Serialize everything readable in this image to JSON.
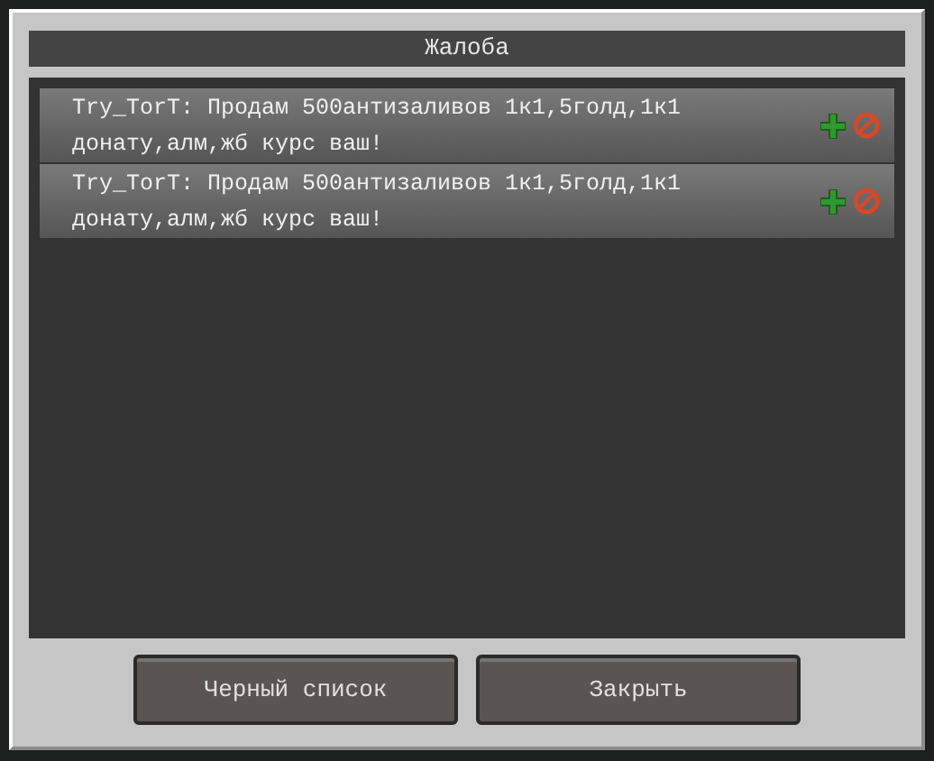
{
  "dialog": {
    "title": "Жалоба",
    "messages": [
      {
        "text": "Try_TorT: Продам 500антизаливов 1к1,5голд,1к1 донату,алм,жб курс ваш!"
      },
      {
        "text": "Try_TorT: Продам 500антизаливов 1к1,5голд,1к1 донату,алм,жб курс ваш!"
      }
    ],
    "buttons": [
      "Черный список",
      "Закрыть"
    ]
  }
}
